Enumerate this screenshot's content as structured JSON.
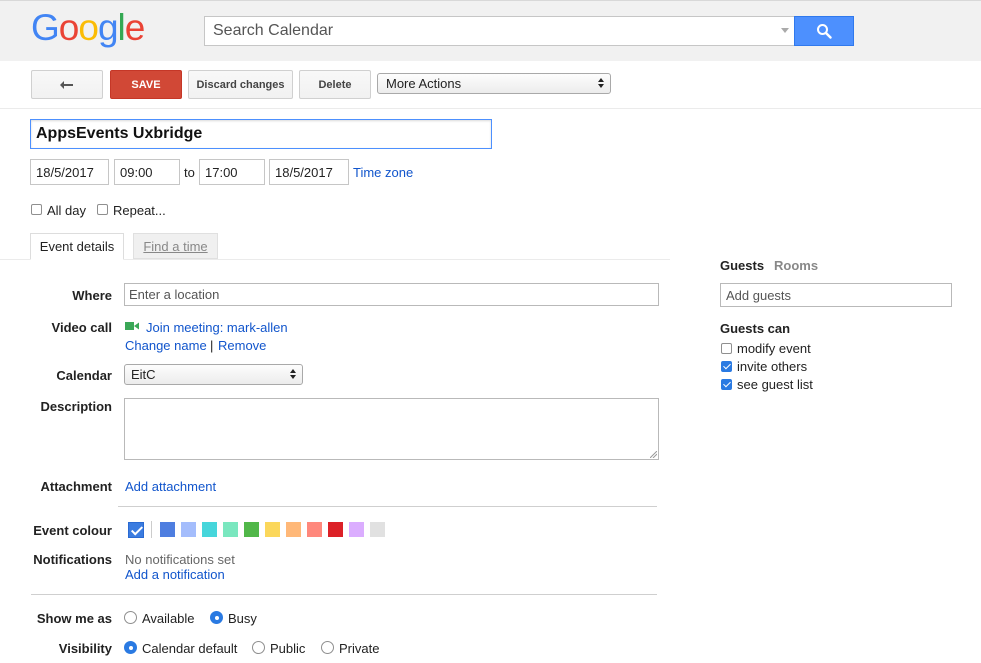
{
  "header": {
    "logo_letters": [
      {
        "ch": "G",
        "color": "#4285F4"
      },
      {
        "ch": "o",
        "color": "#EA4335"
      },
      {
        "ch": "o",
        "color": "#FBBC05"
      },
      {
        "ch": "g",
        "color": "#4285F4"
      },
      {
        "ch": "l",
        "color": "#34A853"
      },
      {
        "ch": "e",
        "color": "#EA4335"
      }
    ],
    "search_placeholder": "Search Calendar",
    "search_icon": "search-icon"
  },
  "toolbar": {
    "back_icon": "back-arrow-icon",
    "save_label": "SAVE",
    "discard_label": "Discard changes",
    "delete_label": "Delete",
    "more_actions_label": "More Actions"
  },
  "event": {
    "title": "AppsEvents Uxbridge",
    "start_date": "18/5/2017",
    "start_time": "09:00",
    "to_label": "to",
    "end_time": "17:00",
    "end_date": "18/5/2017",
    "timezone_label": "Time zone",
    "all_day_label": "All day",
    "all_day_checked": false,
    "repeat_label": "Repeat...",
    "repeat_checked": false
  },
  "tabs": {
    "event_details": "Event details",
    "find_time": "Find a time"
  },
  "details": {
    "where_label": "Where",
    "where_placeholder": "Enter a location",
    "video_call_label": "Video call",
    "video_icon": "video-camera-icon",
    "join_meeting": "Join meeting: mark-allen",
    "change_name": "Change name",
    "separator": "|",
    "remove": "Remove",
    "calendar_label": "Calendar",
    "calendar_value": "EitC",
    "description_label": "Description",
    "attachment_label": "Attachment",
    "add_attachment": "Add attachment",
    "event_colour_label": "Event colour",
    "selected_colour": "#3b7ce0",
    "colours": [
      "#4e7ee0",
      "#a4bdfc",
      "#46d6db",
      "#7ae7bf",
      "#51b749",
      "#fbd75b",
      "#ffb878",
      "#ff887c",
      "#dc2127",
      "#dbadff",
      "#e1e1e1"
    ],
    "notifications_label": "Notifications",
    "no_notifications": "No notifications set",
    "add_notification": "Add a notification",
    "show_me_as_label": "Show me as",
    "available_label": "Available",
    "busy_label": "Busy",
    "show_me_as_value": "Busy",
    "visibility_label": "Visibility",
    "calendar_default_label": "Calendar default",
    "public_label": "Public",
    "private_label": "Private",
    "visibility_value": "Calendar default"
  },
  "guests": {
    "guests_tab": "Guests",
    "rooms_tab": "Rooms",
    "add_guests_placeholder": "Add guests",
    "guests_can_title": "Guests can",
    "modify_event_label": "modify event",
    "modify_event_checked": false,
    "invite_others_label": "invite others",
    "invite_others_checked": true,
    "see_guest_list_label": "see guest list",
    "see_guest_list_checked": true
  }
}
